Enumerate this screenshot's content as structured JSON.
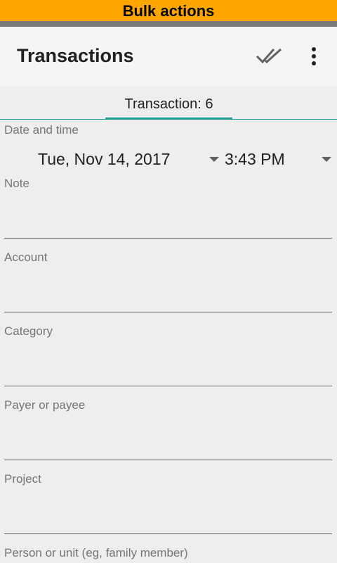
{
  "banner": {
    "label": "Bulk actions",
    "color": "#ffa500"
  },
  "appbar": {
    "title": "Transactions",
    "actions": [
      {
        "icon": "double-check-icon"
      },
      {
        "icon": "more-vertical-icon"
      }
    ]
  },
  "tab": {
    "label": "Transaction: 6",
    "accent": "#1a9a8c"
  },
  "form": {
    "datetime_label": "Date and time",
    "date_value": "Tue, Nov 14, 2017",
    "time_value": "3:43 PM",
    "note_label": "Note",
    "account_label": "Account",
    "category_label": "Category",
    "payee_label": "Payer or payee",
    "project_label": "Project",
    "person_label": "Person or unit (eg, family member)"
  }
}
